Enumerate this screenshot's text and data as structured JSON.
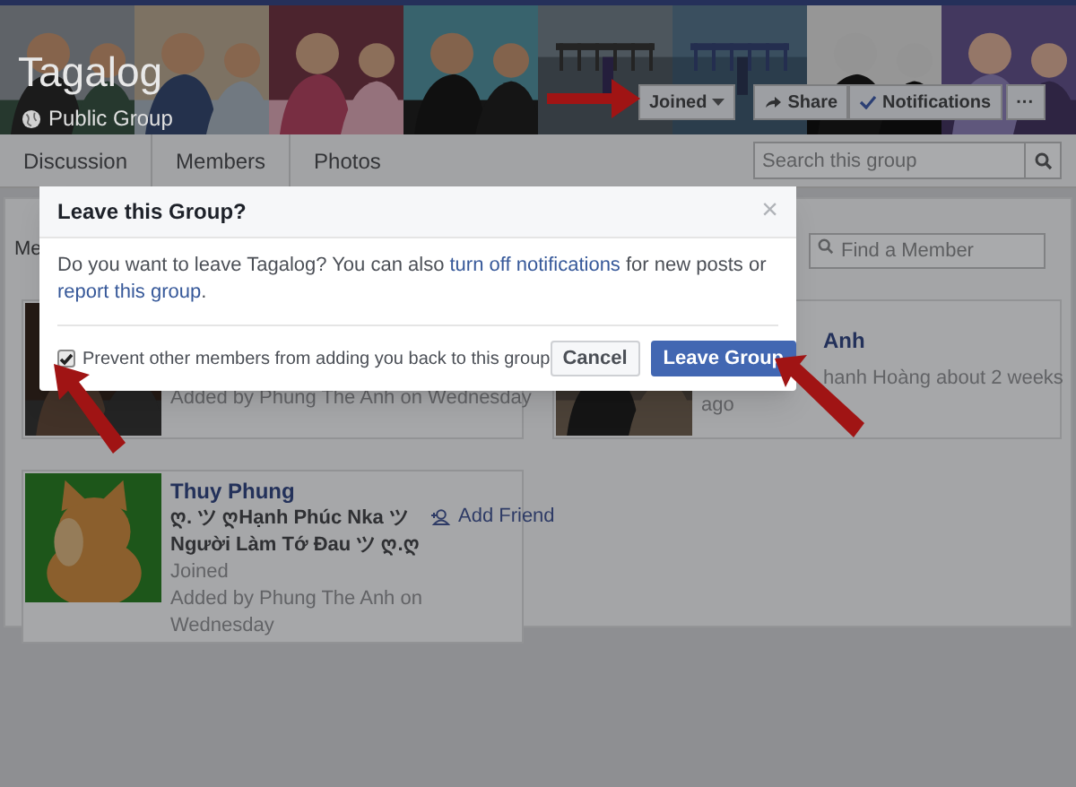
{
  "group": {
    "name": "Tagalog",
    "privacy": "Public Group"
  },
  "actions": [
    {
      "label": "Joined",
      "kind": "dropdown"
    },
    {
      "label": "Share",
      "kind": "share"
    },
    {
      "label": "Notifications",
      "kind": "check"
    },
    {
      "label": "···",
      "kind": "more"
    }
  ],
  "tabs": [
    {
      "label": "Discussion"
    },
    {
      "label": "Members"
    },
    {
      "label": "Photos"
    }
  ],
  "search": {
    "placeholder": "Search this group"
  },
  "members_header": "Me",
  "find_member": {
    "placeholder": "Find a Member"
  },
  "members": [
    {
      "lines": [
        {
          "kind": "meta",
          "text": "Added by Phung The Anh on Wednesday"
        }
      ]
    },
    {
      "name": "Anh",
      "lines": [
        {
          "kind": "meta",
          "text": "hanh Hoàng about 2 weeks"
        },
        {
          "kind": "meta",
          "text": "ago"
        }
      ]
    },
    {
      "name": "Thuy Phung",
      "action": "Add Friend",
      "lines": [
        {
          "kind": "bio",
          "text": "ღ. ツ ღHạnh Phúc Nka ツ"
        },
        {
          "kind": "bio",
          "text": "Người Làm Tớ Đau ツ ღ.ღ"
        },
        {
          "kind": "meta",
          "text": "Joined"
        },
        {
          "kind": "meta",
          "text": "Added by Phung The Anh on"
        },
        {
          "kind": "meta",
          "text": "Wednesday"
        }
      ]
    }
  ],
  "dialog": {
    "title": "Leave this Group?",
    "close": "×",
    "message": [
      {
        "text": "Do you want to leave Tagalog? You can also ",
        "link": false
      },
      {
        "text": "turn off notifications",
        "link": true
      },
      {
        "text": " for new posts or ",
        "link": false
      },
      {
        "text": "report this group",
        "link": true
      },
      {
        "text": ".",
        "link": false
      }
    ],
    "checkbox": {
      "label": "Prevent other members from adding you back to this group",
      "checked": true
    },
    "buttons": [
      {
        "label": "Cancel",
        "kind": "secondary"
      },
      {
        "label": "Leave Group",
        "kind": "primary"
      }
    ]
  }
}
